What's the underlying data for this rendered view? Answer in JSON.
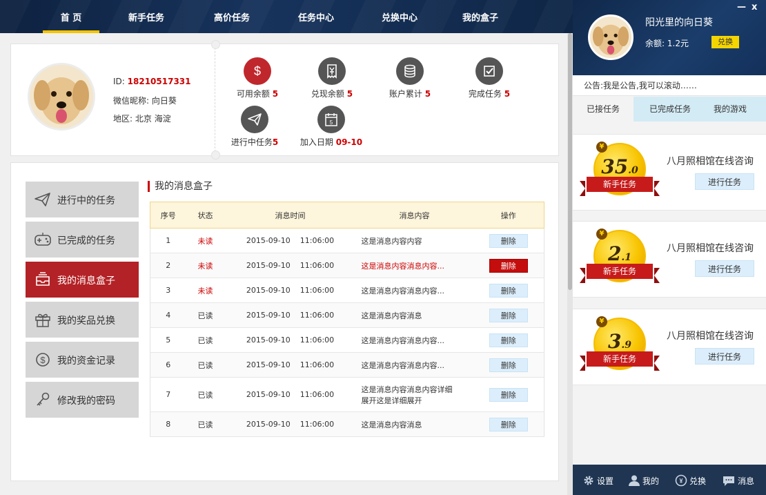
{
  "nav": {
    "items": [
      {
        "label": "首 页",
        "active": true
      },
      {
        "label": "新手任务"
      },
      {
        "label": "高价任务"
      },
      {
        "label": "任务中心"
      },
      {
        "label": "兑换中心"
      },
      {
        "label": "我的盒子"
      }
    ]
  },
  "profile": {
    "id_label": "ID:",
    "id_value": "18210517331",
    "nickname_label": "微信昵称:",
    "nickname_value": "向日葵",
    "region_label": "地区:",
    "region_value": "北京 海淀"
  },
  "stats": [
    {
      "label": "可用余额",
      "value": "5",
      "icon": "dollar-icon"
    },
    {
      "label": "兑现余额",
      "value": "5",
      "icon": "receipt-icon"
    },
    {
      "label": "账户累计",
      "value": "5",
      "icon": "coins-icon"
    },
    {
      "label": "完成任务",
      "value": "5",
      "icon": "checkbox-icon"
    },
    {
      "label": "进行中任务",
      "value": "5",
      "icon": "paper-plane-icon"
    },
    {
      "label": "加入日期",
      "value": "09-10",
      "icon": "calendar-icon"
    }
  ],
  "calendar_day": "5",
  "side_menu": [
    {
      "label": "进行中的任务",
      "icon": "paper-plane-icon"
    },
    {
      "label": "已完成的任务",
      "icon": "gamepad-icon"
    },
    {
      "label": "我的消息盒子",
      "icon": "inbox-icon",
      "active": true
    },
    {
      "label": "我的奖品兑换",
      "icon": "gift-icon"
    },
    {
      "label": "我的资金记录",
      "icon": "dollar-icon"
    },
    {
      "label": "修改我的密码",
      "icon": "key-icon"
    }
  ],
  "messages": {
    "title": "我的消息盒子",
    "columns": [
      "序号",
      "状态",
      "消息时间",
      "消息内容",
      "操作"
    ],
    "rows": [
      {
        "no": "1",
        "status": "未读",
        "date": "2015-09-10",
        "time": "11:06:00",
        "content": "这是消息内容内容",
        "action": "删除"
      },
      {
        "no": "2",
        "status": "未读",
        "date": "2015-09-10",
        "time": "11:06:00",
        "content": "这是消息内容消息内容...",
        "action": "删除"
      },
      {
        "no": "3",
        "status": "未读",
        "date": "2015-09-10",
        "time": "11:06:00",
        "content": "这是消息内容消息内容...",
        "action": "删除"
      },
      {
        "no": "4",
        "status": "已读",
        "date": "2015-09-10",
        "time": "11:06:00",
        "content": "这是消息内容消息",
        "action": "删除"
      },
      {
        "no": "5",
        "status": "已读",
        "date": "2015-09-10",
        "time": "11:06:00",
        "content": "这是消息内容消息内容...",
        "action": "删除"
      },
      {
        "no": "6",
        "status": "已读",
        "date": "2015-09-10",
        "time": "11:06:00",
        "content": "这是消息内容消息内容...",
        "action": "删除"
      },
      {
        "no": "7",
        "status": "已读",
        "date": "2015-09-10",
        "time": "11:06:00",
        "content": "这是消息内容消息内容详细",
        "content2": "展开这是详细展开",
        "action": "删除"
      },
      {
        "no": "8",
        "status": "已读",
        "date": "2015-09-10",
        "time": "11:06:00",
        "content": "这是消息内容消息",
        "action": "删除"
      }
    ]
  },
  "right_panel": {
    "minimize": "—",
    "close": "x",
    "username": "阳光里的向日葵",
    "balance_label": "余额:",
    "balance_value": "1.2元",
    "exchange_label": "兑换",
    "notice": "公告:我是公告,我可以滚动……",
    "tabs": [
      {
        "label": "已接任务",
        "active": true
      },
      {
        "label": "已完成任务"
      },
      {
        "label": "我的游戏"
      }
    ],
    "tasks": [
      {
        "amount_int": "35",
        "amount_dec": ".0",
        "ribbon": "新手任务",
        "title": "八月照相馆在线咨询",
        "button": "进行任务"
      },
      {
        "amount_int": "2",
        "amount_dec": ".1",
        "ribbon": "新手任务",
        "title": "八月照相馆在线咨询",
        "button": "进行任务"
      },
      {
        "amount_int": "3",
        "amount_dec": ".9",
        "ribbon": "新手任务",
        "title": "八月照相馆在线咨询",
        "button": "进行任务"
      }
    ],
    "yen_symbol": "¥",
    "footer": [
      {
        "label": "设置",
        "icon": "gear-icon"
      },
      {
        "label": "我的",
        "icon": "user-icon"
      },
      {
        "label": "兑换",
        "icon": "exchange-icon"
      },
      {
        "label": "消息",
        "icon": "chat-icon"
      }
    ]
  },
  "colors": {
    "nav_bg": "#132c50",
    "accent_red": "#b32226",
    "nav_underline": "#f6c400",
    "button_blue": "#dceefb"
  }
}
